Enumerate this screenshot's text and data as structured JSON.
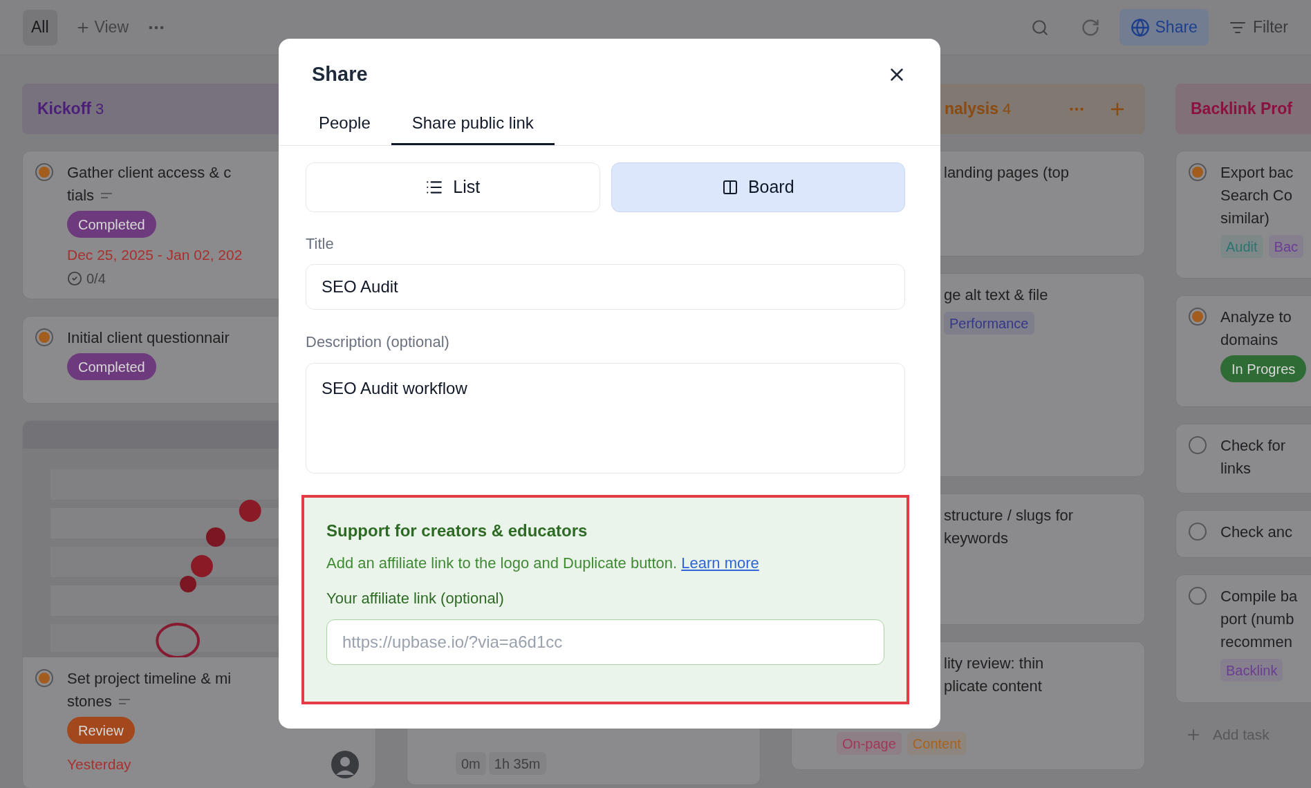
{
  "toolbar": {
    "views": [
      {
        "label": "All",
        "selected": true
      },
      {
        "label": "View",
        "selected": false
      }
    ],
    "share_label": "Share",
    "filter_label": "Filter"
  },
  "columns": [
    {
      "title": "Kickoff",
      "count": "3",
      "color": "#4b1f77",
      "cards": [
        {
          "in_progress": true,
          "has_notes": true,
          "blocks": [
            {
              "kind": "lines",
              "lines": [
                "Gather client access & c",
                "tials"
              ]
            },
            {
              "kind": "pill",
              "label": "Completed",
              "color": "#6e3a7e"
            },
            {
              "kind": "date",
              "text": "Dec 25, 2025 - Jan 02, 202",
              "color": "#a8302e"
            },
            {
              "kind": "checklist",
              "text": "0/4"
            }
          ]
        },
        {
          "in_progress": true,
          "blocks": [
            {
              "kind": "lines",
              "lines": [
                "Initial client questionnair"
              ]
            },
            {
              "kind": "pill",
              "label": "Completed",
              "color": "#6e3a7e"
            }
          ]
        },
        {
          "in_progress": true,
          "has_notes": true,
          "cover": {
            "kind": "picture"
          },
          "blocks": [
            {
              "kind": "lines",
              "lines": [
                "Set project timeline & mi",
                "stones"
              ]
            },
            {
              "kind": "pill",
              "label": "Review",
              "color": "#a2481c"
            },
            {
              "kind": "date",
              "text": "Yesterday",
              "color": "#a8302e",
              "avatar": true
            }
          ]
        }
      ]
    },
    {
      "cards": [
        {
          "blocks": [
            {
              "kind": "timer",
              "chips": [
                "0m",
                "1h 35m"
              ]
            }
          ]
        }
      ]
    },
    {
      "title": "nalysis",
      "count": "4",
      "color": "#8a4a10",
      "cards": [
        {
          "blocks": [
            {
              "kind": "lines",
              "lines": [
                "landing pages (top"
              ]
            }
          ]
        },
        {
          "blocks": [
            {
              "kind": "lines",
              "lines": [
                "ge alt text & file"
              ]
            },
            {
              "kind": "tags",
              "tags": [
                {
                  "label": "Performance",
                  "color": "#34378a"
                }
              ]
            }
          ]
        },
        {
          "blocks": [
            {
              "kind": "lines",
              "lines": [
                "structure / slugs for",
                "keywords"
              ]
            }
          ]
        },
        {
          "blocks": [
            {
              "kind": "lines",
              "lines": [
                "lity review: thin",
                "plicate content"
              ]
            },
            {
              "kind": "tags",
              "tags": [
                {
                  "label": "On-page",
                  "color": "#a33658"
                },
                {
                  "label": "Content",
                  "color": "#a8621c"
                }
              ]
            }
          ]
        }
      ]
    },
    {
      "title": "Backlink Prof",
      "color": "#8c1040",
      "add_task": "Add task",
      "cards": [
        {
          "in_progress": true,
          "blocks": [
            {
              "kind": "lines",
              "lines": [
                "Export bac",
                "Search Co",
                "similar)"
              ]
            },
            {
              "kind": "tags",
              "tags": [
                {
                  "label": "Audit",
                  "color": "#2a7570"
                },
                {
                  "label": "Bac",
                  "color": "#6b3c94"
                }
              ]
            }
          ]
        },
        {
          "in_progress": true,
          "blocks": [
            {
              "kind": "lines",
              "lines": [
                "Analyze to",
                "domains"
              ]
            },
            {
              "kind": "pill",
              "label": "In Progres",
              "color": "#2e6b35"
            }
          ]
        },
        {
          "in_progress": false,
          "blocks": [
            {
              "kind": "lines",
              "lines": [
                "Check for",
                "links"
              ]
            }
          ]
        },
        {
          "in_progress": false,
          "blocks": [
            {
              "kind": "lines",
              "lines": [
                "Check anc"
              ]
            }
          ]
        },
        {
          "in_progress": false,
          "blocks": [
            {
              "kind": "lines",
              "lines": [
                "Compile ba",
                "port (numb",
                "recommen"
              ]
            },
            {
              "kind": "tags",
              "tags": [
                {
                  "label": "Backlink",
                  "color": "#6b3c94"
                }
              ]
            }
          ]
        }
      ]
    }
  ],
  "modal": {
    "title": "Share",
    "tabs": [
      {
        "label": "People",
        "selected": false
      },
      {
        "label": "Share public link",
        "selected": true
      }
    ],
    "view_toggle": [
      {
        "label": "List",
        "kind": "list",
        "selected": false
      },
      {
        "label": "Board",
        "kind": "board",
        "selected": true
      }
    ],
    "title_field": {
      "label": "Title",
      "value": "SEO Audit"
    },
    "description_field": {
      "label": "Description (optional)",
      "value": "SEO Audit workflow"
    },
    "affiliate": {
      "heading": "Support for creators & educators",
      "text": "Add an affiliate link to the logo and Duplicate button.",
      "link": "Learn more",
      "field_label": "Your affiliate link (optional)",
      "placeholder": "https://upbase.io/?via=a6d1cc"
    }
  }
}
